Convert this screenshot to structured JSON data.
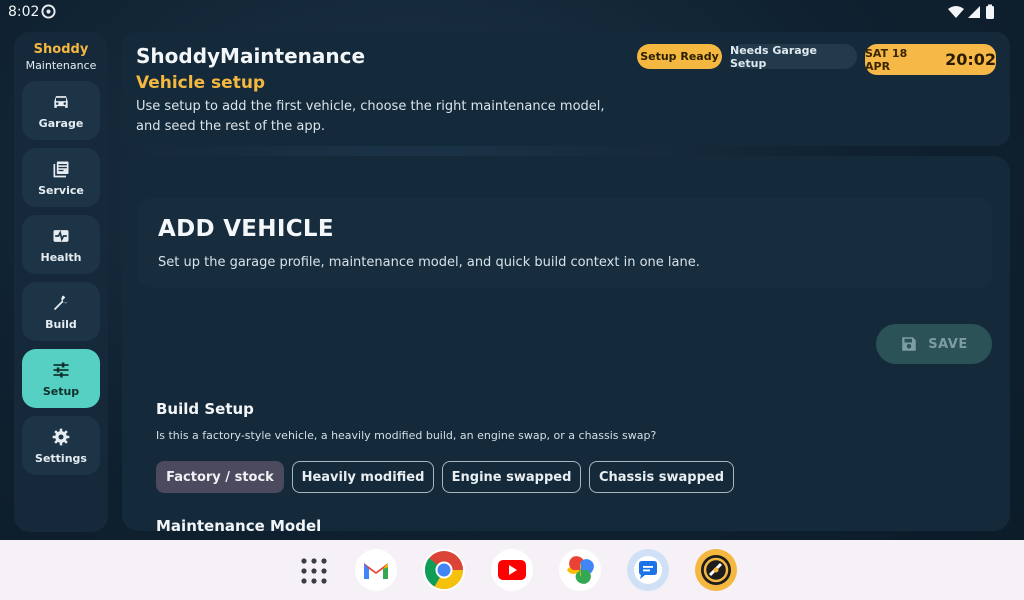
{
  "status_bar": {
    "time": "8:02"
  },
  "rail": {
    "brand_name": "Shoddy",
    "brand_sub": "Maintenance",
    "items": [
      {
        "label": "Garage",
        "icon": "car-icon"
      },
      {
        "label": "Service",
        "icon": "notes-icon"
      },
      {
        "label": "Health",
        "icon": "monitor-heart-icon"
      },
      {
        "label": "Build",
        "icon": "wrench-icon"
      },
      {
        "label": "Setup",
        "icon": "sliders-icon",
        "active": true
      },
      {
        "label": "Settings",
        "icon": "gear-icon"
      }
    ]
  },
  "header": {
    "app_title": "ShoddyMaintenance",
    "page_subtitle": "Vehicle setup",
    "page_desc": "Use setup to add the first vehicle, choose the right maintenance model, and seed the rest of the app.",
    "chip_ready": "Setup Ready",
    "chip_garage": "Needs Garage Setup",
    "clock_date": "SAT 18 APR",
    "clock_time": "20:02"
  },
  "main": {
    "hero_title": "ADD VEHICLE",
    "hero_desc": "Set up the garage profile, maintenance model, and quick build context in one lane.",
    "save_label": "SAVE",
    "build_setup_title": "Build Setup",
    "build_setup_question": "Is this a factory-style vehicle, a heavily modified build, an engine swap, or a chassis swap?",
    "build_options": [
      "Factory / stock",
      "Heavily modified",
      "Engine swapped",
      "Chassis swapped"
    ],
    "selected_option": "Factory / stock",
    "maintenance_model_title": "Maintenance Model"
  },
  "dock": {
    "apps": [
      "gmail-icon",
      "chrome-icon",
      "youtube-icon",
      "photos-icon",
      "messages-icon",
      "shoddy-app-icon"
    ]
  },
  "colors": {
    "accent_amber": "#f4b740",
    "active_teal": "#55d0c2",
    "background": "#0f2130"
  }
}
